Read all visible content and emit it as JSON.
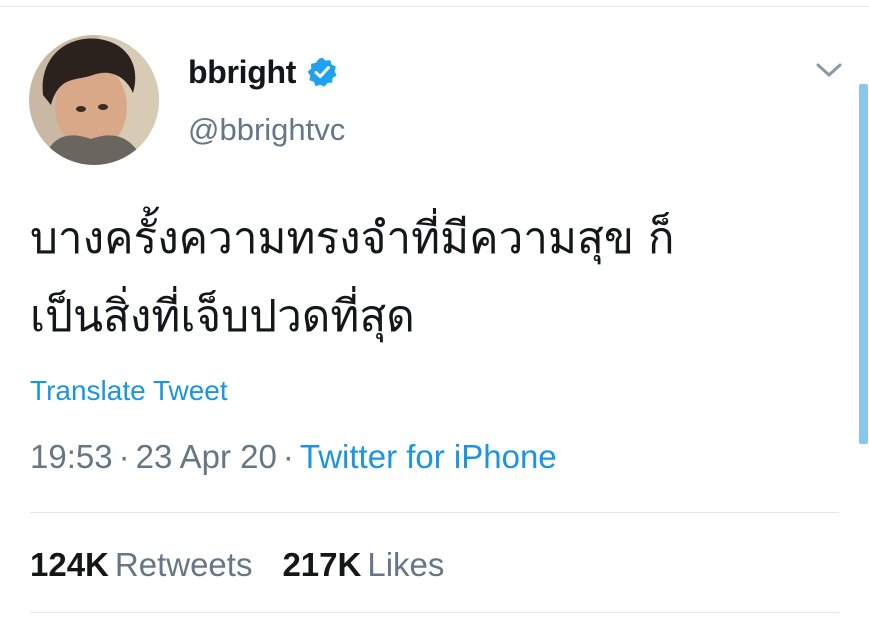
{
  "tweet": {
    "display_name": "bbright",
    "handle": "@bbrightvc",
    "text_lines": [
      "บางครั้งความทรงจำที่มีความสุข ก็",
      "เป็นสิ่งที่เจ็บปวดที่สุด"
    ],
    "translate_label": "Translate Tweet",
    "time": "19:53",
    "separator": "·",
    "date": "23 Apr 20",
    "source": "Twitter for iPhone",
    "retweets_count": "124K",
    "retweets_label": "Retweets",
    "likes_count": "217K",
    "likes_label": "Likes"
  },
  "icons": {
    "verified": "verified-badge-icon",
    "menu": "chevron-down-icon"
  },
  "colors": {
    "link": "#1b95e0",
    "muted": "#657786",
    "verified": "#1da1f2"
  }
}
